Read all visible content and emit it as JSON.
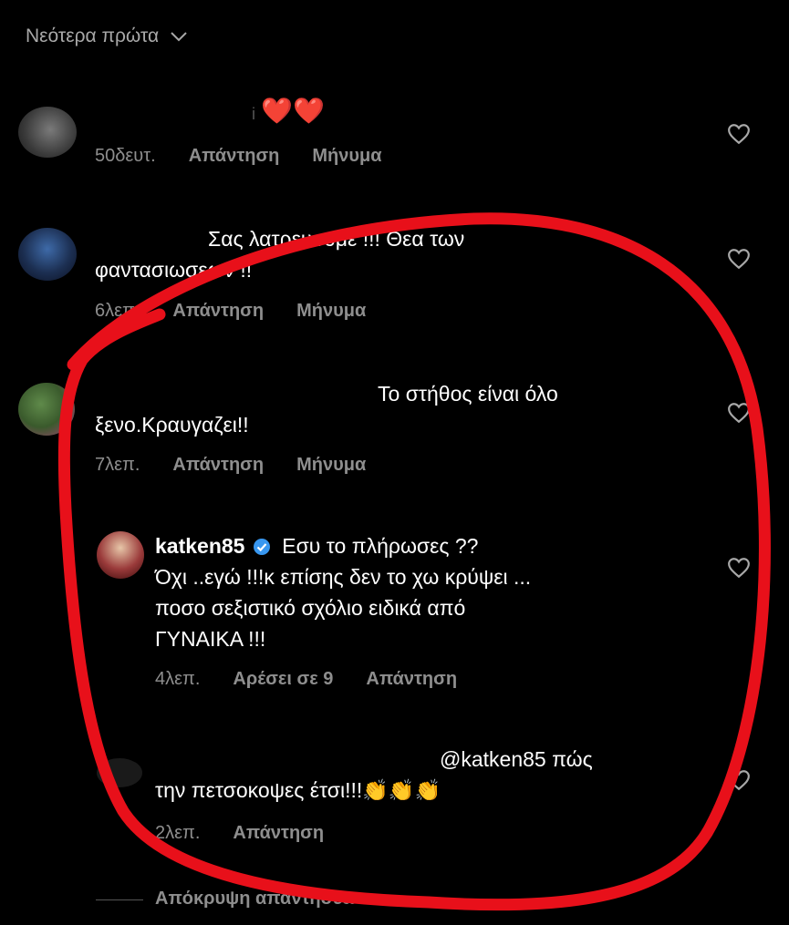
{
  "sort": {
    "label": "Νεότερα πρώτα"
  },
  "comments": [
    {
      "text": "❤️❤️",
      "meta": {
        "time": "50δευτ.",
        "reply": "Απάντηση",
        "message": "Μήνυμα"
      }
    },
    {
      "line1": "Σας λατρευουμε !!! Θεα των",
      "line2": "φαντασιωσεων !!",
      "meta": {
        "time": "6λεπ.",
        "reply": "Απάντηση",
        "message": "Μήνυμα"
      }
    },
    {
      "line1_partial": "Το στήθος είναι όλο",
      "line2": "ξενο.Κραυγαζει!!",
      "meta": {
        "time": "7λεπ.",
        "reply": "Απάντηση",
        "message": "Μήνυμα"
      }
    }
  ],
  "reply": {
    "username": "katken85",
    "line1": "Εσυ το πλήρωσες ??",
    "line2": "Όχι ..εγώ !!!κ επίσης δεν το χω κρύψει ...",
    "line3": "ποσο σεξιστικό σχόλιο ειδικά από",
    "line4": "ΓΥΝΑΙΚΑ !!!",
    "meta": {
      "time": "4λεπ.",
      "likes": "Αρέσει σε 9",
      "reply": "Απάντηση"
    }
  },
  "reply2": {
    "mention_line": "@katken85 πώς",
    "line2": "την πετσοκοψες έτσι!!!👏👏👏",
    "meta": {
      "time": "2λεπ.",
      "reply": "Απάντηση"
    }
  },
  "hide_replies": {
    "label": "Απόκρυψη απαντήσεων"
  },
  "colors": {
    "background": "#000000",
    "meta": "#8e8e8e",
    "annotation": "#e8101a",
    "verified": "#3897f0"
  }
}
